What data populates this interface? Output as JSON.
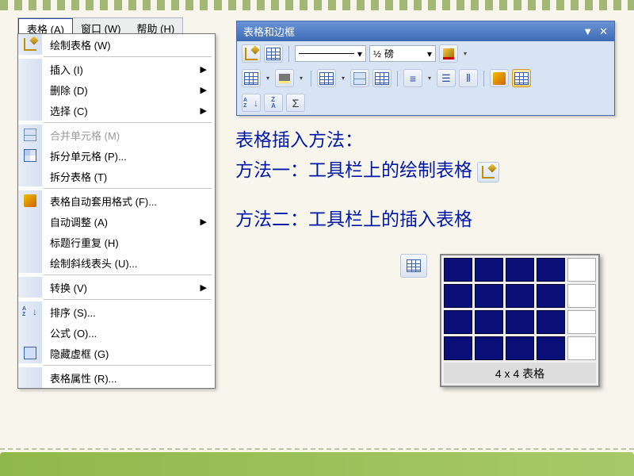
{
  "menubar": {
    "items": [
      "表格 (A)",
      "窗口 (W)",
      "帮助 (H)"
    ],
    "activeIndex": 0
  },
  "dropdown": {
    "draw": "绘制表格 (W)",
    "insert": "插入 (I)",
    "delete": "删除 (D)",
    "select": "选择 (C)",
    "merge": "合并单元格 (M)",
    "splitCell": "拆分单元格 (P)...",
    "splitTable": "拆分表格 (T)",
    "autofmt": "表格自动套用格式 (F)...",
    "autofit": "自动调整 (A)",
    "repeatHead": "标题行重复 (H)",
    "diagHead": "绘制斜线表头 (U)...",
    "convert": "转换 (V)",
    "sort": "排序 (S)...",
    "formula": "公式 (O)...",
    "hideGrid": "隐藏虚框 (G)",
    "props": "表格属性 (R)..."
  },
  "toolbar": {
    "title": "表格和边框",
    "weightLeft": "½",
    "weightRight": "磅"
  },
  "instructions": {
    "heading": "表格插入方法：",
    "line1": "方法一：工具栏上的绘制表格",
    "line2": "方法二：工具栏上的插入表格"
  },
  "preview": {
    "cols": 5,
    "rows": 4,
    "selCols": 4,
    "selRows": 4,
    "caption": "4 x 4 表格"
  }
}
